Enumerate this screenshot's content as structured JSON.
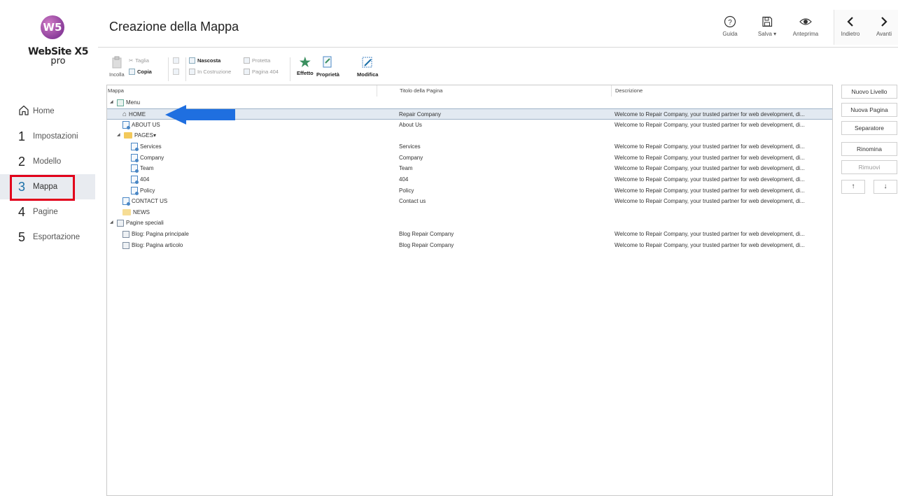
{
  "app": {
    "logo_mark": "W5",
    "logo_name": "WebSite X5",
    "logo_edition": "pro"
  },
  "sidebar": {
    "items": [
      {
        "num": "",
        "label": "Home",
        "icon": "home-icon"
      },
      {
        "num": "1",
        "label": "Impostazioni"
      },
      {
        "num": "2",
        "label": "Modello"
      },
      {
        "num": "3",
        "label": "Mappa",
        "active": true
      },
      {
        "num": "4",
        "label": "Pagine"
      },
      {
        "num": "5",
        "label": "Esportazione"
      }
    ]
  },
  "header": {
    "title": "Creazione della Mappa",
    "help": "Guida",
    "save": "Salva ▾",
    "preview": "Anteprima",
    "back": "Indietro",
    "forward": "Avanti"
  },
  "toolbar": {
    "paste": "Incolla",
    "cut": "Taglia",
    "copy": "Copia",
    "hidden": "Nascosta",
    "protected": "Protetta",
    "under_construction": "In Costruzione",
    "page_404": "Pagina 404",
    "effect": "Effetto",
    "properties": "Proprietà",
    "edit": "Modifica"
  },
  "tree": {
    "columns": [
      "Mappa",
      "Titolo della Pagina",
      "Descrizione"
    ],
    "rows": [
      {
        "name": "Menu",
        "title": "",
        "desc": ""
      },
      {
        "name": "HOME",
        "title": "Repair Company",
        "desc": "Welcome to Repair Company, your trusted partner for web development, di..."
      },
      {
        "name": "ABOUT US",
        "title": "About Us",
        "desc": "Welcome to Repair Company, your trusted partner for web development, di..."
      },
      {
        "name": "PAGES▾",
        "title": "",
        "desc": ""
      },
      {
        "name": "Services",
        "title": "Services",
        "desc": "Welcome to Repair Company, your trusted partner for web development, di..."
      },
      {
        "name": "Company",
        "title": "Company",
        "desc": "Welcome to Repair Company, your trusted partner for web development, di..."
      },
      {
        "name": "Team",
        "title": "Team",
        "desc": "Welcome to Repair Company, your trusted partner for web development, di..."
      },
      {
        "name": "404",
        "title": "404",
        "desc": "Welcome to Repair Company, your trusted partner for web development, di..."
      },
      {
        "name": "Policy",
        "title": "Policy",
        "desc": "Welcome to Repair Company, your trusted partner for web development, di..."
      },
      {
        "name": "CONTACT US",
        "title": "Contact us",
        "desc": "Welcome to Repair Company, your trusted partner for web development, di..."
      },
      {
        "name": "NEWS",
        "title": "",
        "desc": ""
      },
      {
        "name": "Pagine speciali",
        "title": "",
        "desc": ""
      },
      {
        "name": "Blog: Pagina principale",
        "title": "Blog Repair Company",
        "desc": "Welcome to Repair Company, your trusted partner for web development, di..."
      },
      {
        "name": "Blog: Pagina articolo",
        "title": "Blog Repair Company",
        "desc": "Welcome to Repair Company, your trusted partner for web development, di..."
      }
    ]
  },
  "actions": {
    "new_level": "Nuovo Livello",
    "new_page": "Nuova Pagina",
    "separator": "Separatore",
    "rename": "Rinomina",
    "remove": "Rimuovi",
    "move_up": "↑",
    "move_down": "↓"
  },
  "colors": {
    "accent": "#1b6fa8",
    "highlight_box": "#e2001a",
    "arrow": "#1f6fe0",
    "selected_row": "#e2e9f1"
  }
}
